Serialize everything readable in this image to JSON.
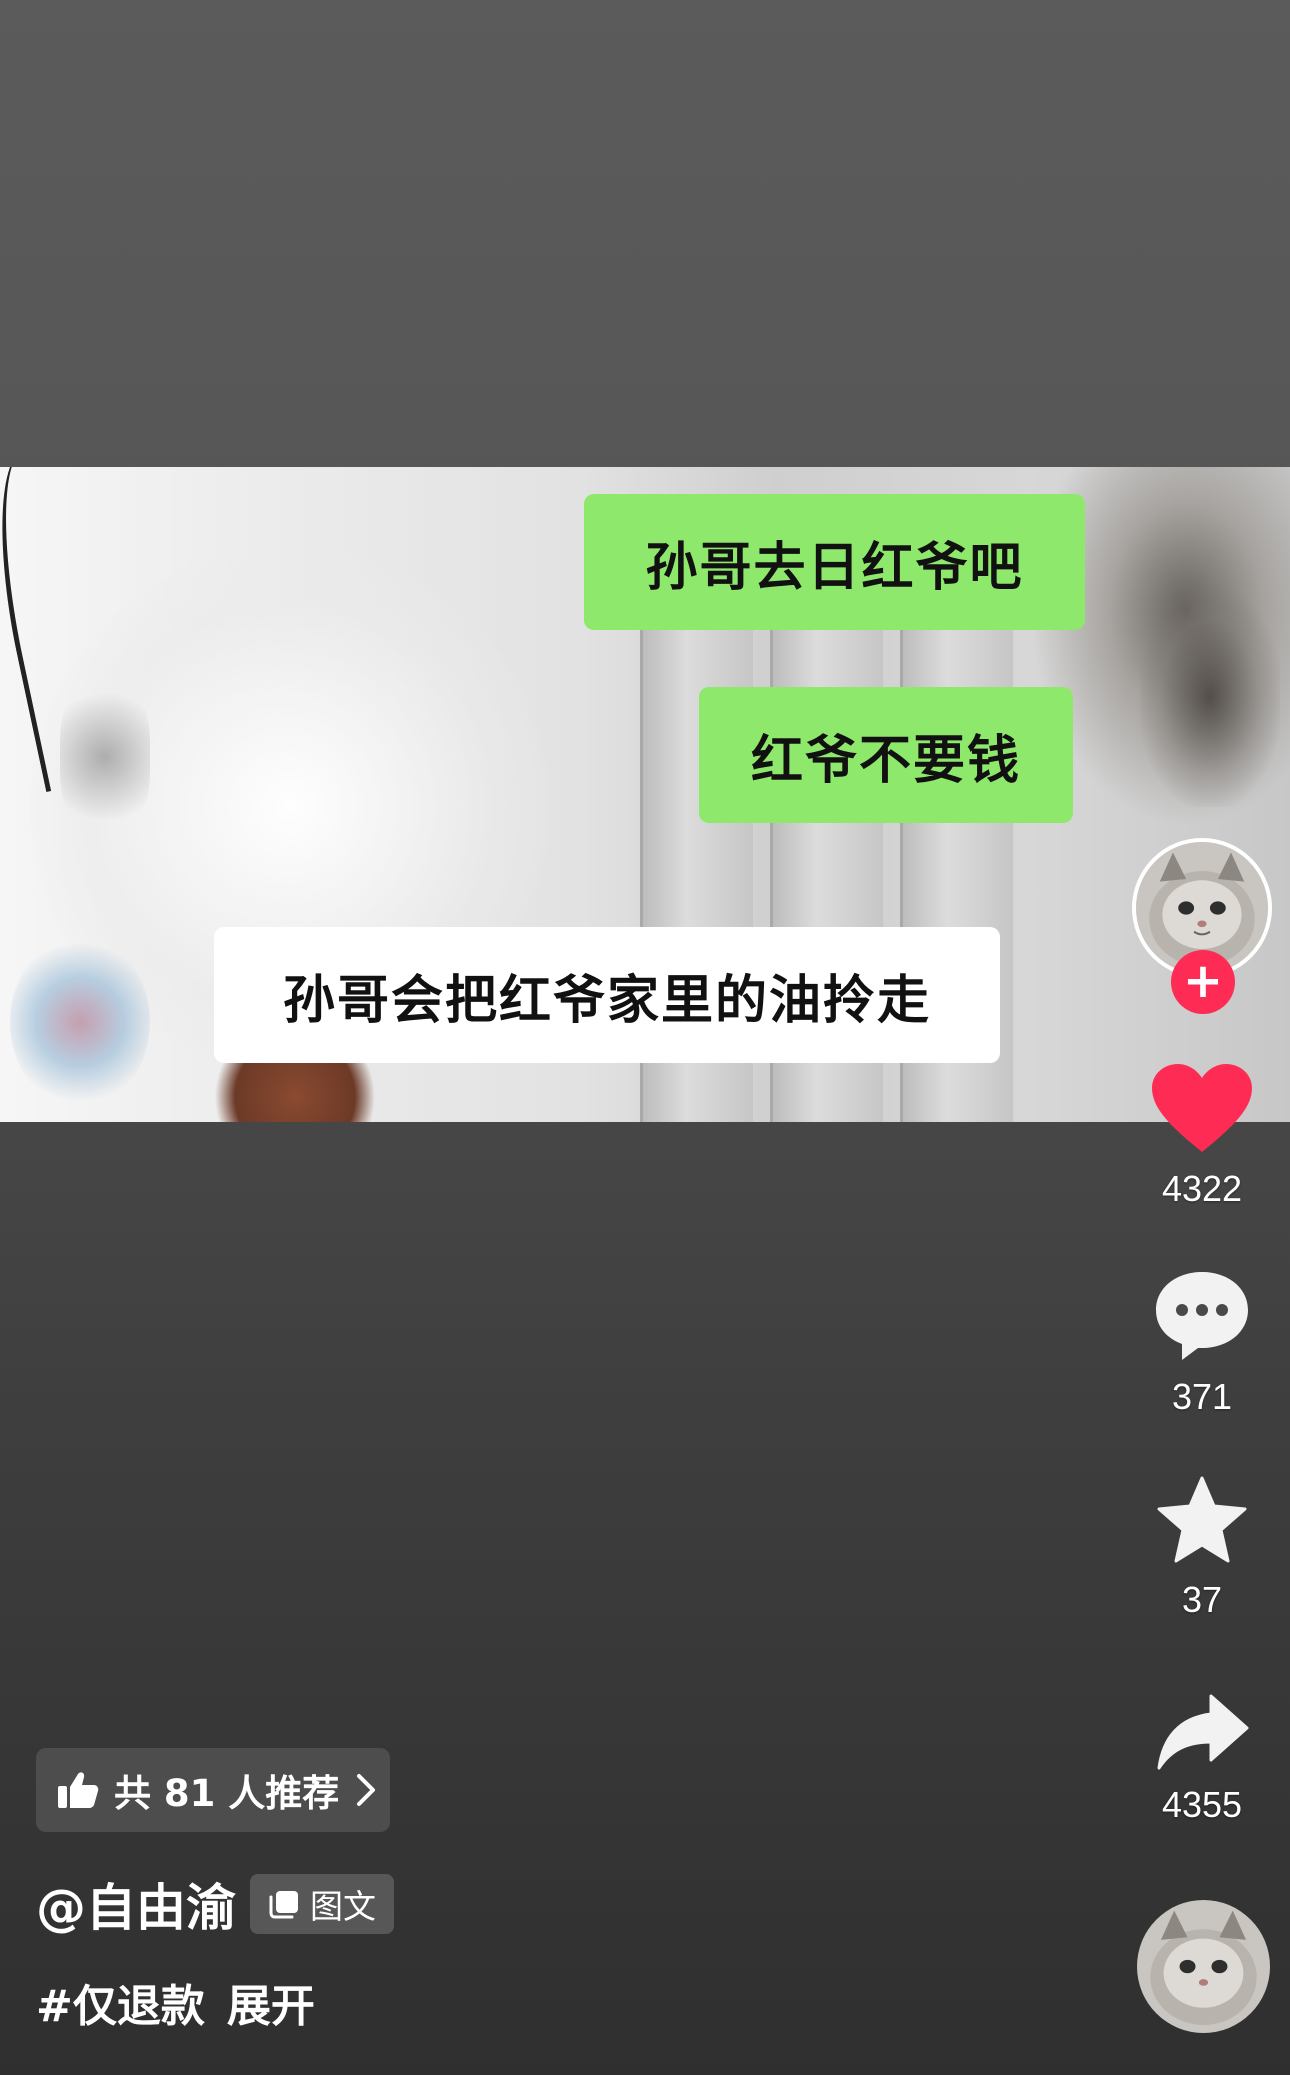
{
  "post": {
    "chat_lines": [
      "孙哥去日红爷吧",
      "红爷不要钱",
      "孙哥会把红爷家里的油拎走"
    ]
  },
  "actions": {
    "follow_symbol": "+",
    "like_count": "4322",
    "comment_count": "371",
    "favorite_count": "37",
    "share_count": "4355"
  },
  "recommend": {
    "label": "共 81 人推荐"
  },
  "author": {
    "handle": "@自由渝",
    "type_badge": "图文"
  },
  "caption": {
    "hashtag": "#仅退款",
    "expand_label": "展开"
  },
  "colors": {
    "like": "#fe2c55",
    "follow": "#fe2c55",
    "chat_bubble_green": "#8ee86b",
    "chat_bubble_white": "#ffffff"
  },
  "icons": {
    "like": "heart-icon",
    "comment": "comment-dots-icon",
    "favorite": "star-icon",
    "share": "share-arrow-icon",
    "recommend": "thumbs-up-icon",
    "badge": "image-stack-icon"
  }
}
